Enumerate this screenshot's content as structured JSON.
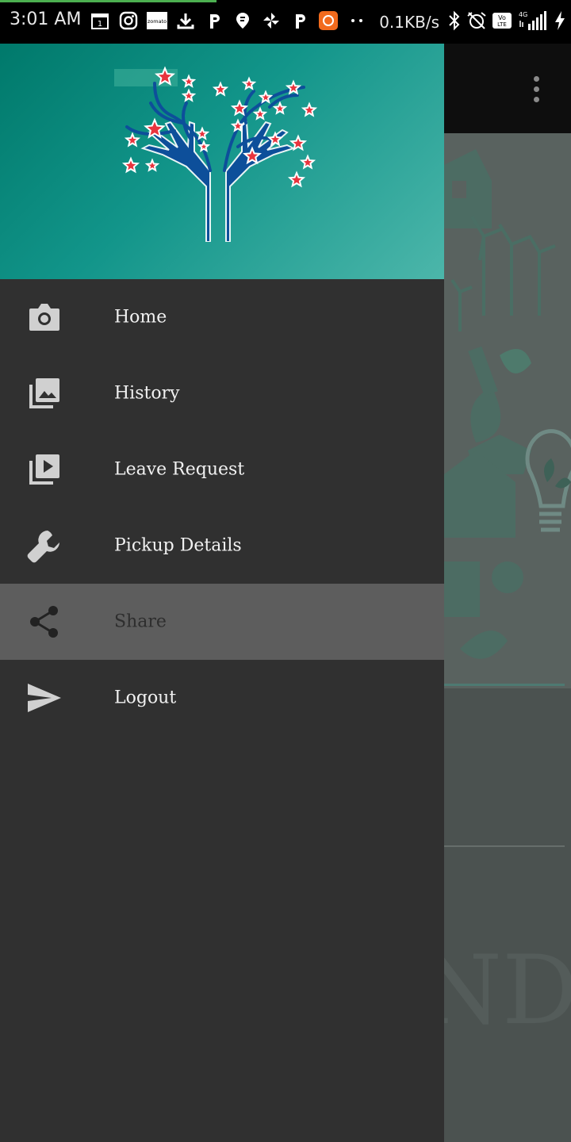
{
  "status_bar": {
    "time": "3:01 AM",
    "network_speed": "0.1KB/s",
    "notification_icons": [
      "calendar-icon",
      "instagram-icon",
      "zomato-icon",
      "download-icon",
      "paytm-icon",
      "swiggy-icon",
      "pinwheel-icon",
      "paytm-icon",
      "app-icon",
      "more-dots-icon"
    ],
    "system_icons": [
      "bluetooth-icon",
      "alarm-off-icon",
      "volte-icon",
      "signal-icon",
      "charging-icon"
    ],
    "zomato_text": "zomato",
    "volte_text": "Vo LTE",
    "network_type": "4G"
  },
  "drawer": {
    "header": {
      "logo": "tree-hands-stars-logo"
    },
    "menu": [
      {
        "label": "Home",
        "icon": "camera-icon",
        "active": false
      },
      {
        "label": "History",
        "icon": "photo-library-icon",
        "active": false
      },
      {
        "label": "Leave Request",
        "icon": "video-library-icon",
        "active": false
      },
      {
        "label": "Pickup Details",
        "icon": "wrench-icon",
        "active": false
      },
      {
        "label": "Share",
        "icon": "share-icon",
        "active": true
      },
      {
        "label": "Logout",
        "icon": "send-icon",
        "active": false
      }
    ]
  },
  "background_app": {
    "toolbar": {
      "overflow_menu": "more-vert-icon"
    },
    "partial_text": "ND"
  },
  "colors": {
    "drawer_bg": "#303030",
    "header_gradient_start": "#00796b",
    "header_gradient_end": "#4cb6aa",
    "active_item_bg": "#5d5d5d",
    "icon_color": "#d0d0d0",
    "logo_blue": "#0d4f9a",
    "star_red": "#e8343e"
  }
}
